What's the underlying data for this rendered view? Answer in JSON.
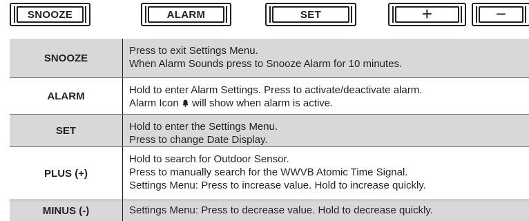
{
  "buttons": [
    {
      "label": "SNOOZE"
    },
    {
      "label": "ALARM"
    },
    {
      "label": "SET"
    },
    {
      "label": "+"
    },
    {
      "label": "−"
    }
  ],
  "rows": [
    {
      "key": "SNOOZE",
      "lines": [
        "Press to exit Settings Menu.",
        "When Alarm Sounds press to Snooze Alarm for 10 minutes."
      ]
    },
    {
      "key": "ALARM",
      "lines": [
        "Hold to enter Alarm Settings. Press to activate/deactivate alarm.",
        "Alarm Icon",
        "will show when alarm is active."
      ]
    },
    {
      "key": "SET",
      "lines": [
        "Hold to enter the Settings Menu.",
        "Press to change Date Display."
      ]
    },
    {
      "key": "PLUS (+)",
      "lines": [
        "Hold to search for Outdoor Sensor.",
        "Press to manually search for the WWVB Atomic Time Signal.",
        "Settings Menu: Press to increase value. Hold to increase quickly."
      ]
    },
    {
      "key": "MINUS (-)",
      "lines": [
        "Settings Menu: Press to decrease value. Hold to decrease quickly."
      ]
    }
  ],
  "icons": {
    "alarm": "bell-icon"
  },
  "colors": {
    "text": "#231f20",
    "shade": "#d8d8d8",
    "border": "#231f20"
  }
}
